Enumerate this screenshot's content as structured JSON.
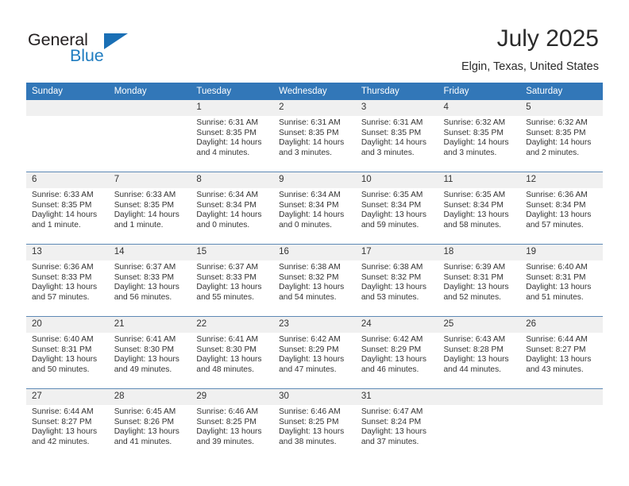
{
  "brand": {
    "name_part1": "General",
    "name_part2": "Blue",
    "accent_color": "#1f7cc0"
  },
  "header": {
    "title": "July 2025",
    "location": "Elgin, Texas, United States"
  },
  "calendar": {
    "header_bg": "#3277b8",
    "daynum_bg": "#f0f0f0",
    "weekday_names": [
      "Sunday",
      "Monday",
      "Tuesday",
      "Wednesday",
      "Thursday",
      "Friday",
      "Saturday"
    ],
    "weeks": [
      [
        {
          "day": "",
          "blank": true
        },
        {
          "day": "",
          "blank": true
        },
        {
          "day": "1",
          "sunrise": "Sunrise: 6:31 AM",
          "sunset": "Sunset: 8:35 PM",
          "daylight_l1": "Daylight: 14 hours",
          "daylight_l2": "and 4 minutes."
        },
        {
          "day": "2",
          "sunrise": "Sunrise: 6:31 AM",
          "sunset": "Sunset: 8:35 PM",
          "daylight_l1": "Daylight: 14 hours",
          "daylight_l2": "and 3 minutes."
        },
        {
          "day": "3",
          "sunrise": "Sunrise: 6:31 AM",
          "sunset": "Sunset: 8:35 PM",
          "daylight_l1": "Daylight: 14 hours",
          "daylight_l2": "and 3 minutes."
        },
        {
          "day": "4",
          "sunrise": "Sunrise: 6:32 AM",
          "sunset": "Sunset: 8:35 PM",
          "daylight_l1": "Daylight: 14 hours",
          "daylight_l2": "and 3 minutes."
        },
        {
          "day": "5",
          "sunrise": "Sunrise: 6:32 AM",
          "sunset": "Sunset: 8:35 PM",
          "daylight_l1": "Daylight: 14 hours",
          "daylight_l2": "and 2 minutes."
        }
      ],
      [
        {
          "day": "6",
          "sunrise": "Sunrise: 6:33 AM",
          "sunset": "Sunset: 8:35 PM",
          "daylight_l1": "Daylight: 14 hours",
          "daylight_l2": "and 1 minute."
        },
        {
          "day": "7",
          "sunrise": "Sunrise: 6:33 AM",
          "sunset": "Sunset: 8:35 PM",
          "daylight_l1": "Daylight: 14 hours",
          "daylight_l2": "and 1 minute."
        },
        {
          "day": "8",
          "sunrise": "Sunrise: 6:34 AM",
          "sunset": "Sunset: 8:34 PM",
          "daylight_l1": "Daylight: 14 hours",
          "daylight_l2": "and 0 minutes."
        },
        {
          "day": "9",
          "sunrise": "Sunrise: 6:34 AM",
          "sunset": "Sunset: 8:34 PM",
          "daylight_l1": "Daylight: 14 hours",
          "daylight_l2": "and 0 minutes."
        },
        {
          "day": "10",
          "sunrise": "Sunrise: 6:35 AM",
          "sunset": "Sunset: 8:34 PM",
          "daylight_l1": "Daylight: 13 hours",
          "daylight_l2": "and 59 minutes."
        },
        {
          "day": "11",
          "sunrise": "Sunrise: 6:35 AM",
          "sunset": "Sunset: 8:34 PM",
          "daylight_l1": "Daylight: 13 hours",
          "daylight_l2": "and 58 minutes."
        },
        {
          "day": "12",
          "sunrise": "Sunrise: 6:36 AM",
          "sunset": "Sunset: 8:34 PM",
          "daylight_l1": "Daylight: 13 hours",
          "daylight_l2": "and 57 minutes."
        }
      ],
      [
        {
          "day": "13",
          "sunrise": "Sunrise: 6:36 AM",
          "sunset": "Sunset: 8:33 PM",
          "daylight_l1": "Daylight: 13 hours",
          "daylight_l2": "and 57 minutes."
        },
        {
          "day": "14",
          "sunrise": "Sunrise: 6:37 AM",
          "sunset": "Sunset: 8:33 PM",
          "daylight_l1": "Daylight: 13 hours",
          "daylight_l2": "and 56 minutes."
        },
        {
          "day": "15",
          "sunrise": "Sunrise: 6:37 AM",
          "sunset": "Sunset: 8:33 PM",
          "daylight_l1": "Daylight: 13 hours",
          "daylight_l2": "and 55 minutes."
        },
        {
          "day": "16",
          "sunrise": "Sunrise: 6:38 AM",
          "sunset": "Sunset: 8:32 PM",
          "daylight_l1": "Daylight: 13 hours",
          "daylight_l2": "and 54 minutes."
        },
        {
          "day": "17",
          "sunrise": "Sunrise: 6:38 AM",
          "sunset": "Sunset: 8:32 PM",
          "daylight_l1": "Daylight: 13 hours",
          "daylight_l2": "and 53 minutes."
        },
        {
          "day": "18",
          "sunrise": "Sunrise: 6:39 AM",
          "sunset": "Sunset: 8:31 PM",
          "daylight_l1": "Daylight: 13 hours",
          "daylight_l2": "and 52 minutes."
        },
        {
          "day": "19",
          "sunrise": "Sunrise: 6:40 AM",
          "sunset": "Sunset: 8:31 PM",
          "daylight_l1": "Daylight: 13 hours",
          "daylight_l2": "and 51 minutes."
        }
      ],
      [
        {
          "day": "20",
          "sunrise": "Sunrise: 6:40 AM",
          "sunset": "Sunset: 8:31 PM",
          "daylight_l1": "Daylight: 13 hours",
          "daylight_l2": "and 50 minutes."
        },
        {
          "day": "21",
          "sunrise": "Sunrise: 6:41 AM",
          "sunset": "Sunset: 8:30 PM",
          "daylight_l1": "Daylight: 13 hours",
          "daylight_l2": "and 49 minutes."
        },
        {
          "day": "22",
          "sunrise": "Sunrise: 6:41 AM",
          "sunset": "Sunset: 8:30 PM",
          "daylight_l1": "Daylight: 13 hours",
          "daylight_l2": "and 48 minutes."
        },
        {
          "day": "23",
          "sunrise": "Sunrise: 6:42 AM",
          "sunset": "Sunset: 8:29 PM",
          "daylight_l1": "Daylight: 13 hours",
          "daylight_l2": "and 47 minutes."
        },
        {
          "day": "24",
          "sunrise": "Sunrise: 6:42 AM",
          "sunset": "Sunset: 8:29 PM",
          "daylight_l1": "Daylight: 13 hours",
          "daylight_l2": "and 46 minutes."
        },
        {
          "day": "25",
          "sunrise": "Sunrise: 6:43 AM",
          "sunset": "Sunset: 8:28 PM",
          "daylight_l1": "Daylight: 13 hours",
          "daylight_l2": "and 44 minutes."
        },
        {
          "day": "26",
          "sunrise": "Sunrise: 6:44 AM",
          "sunset": "Sunset: 8:27 PM",
          "daylight_l1": "Daylight: 13 hours",
          "daylight_l2": "and 43 minutes."
        }
      ],
      [
        {
          "day": "27",
          "sunrise": "Sunrise: 6:44 AM",
          "sunset": "Sunset: 8:27 PM",
          "daylight_l1": "Daylight: 13 hours",
          "daylight_l2": "and 42 minutes."
        },
        {
          "day": "28",
          "sunrise": "Sunrise: 6:45 AM",
          "sunset": "Sunset: 8:26 PM",
          "daylight_l1": "Daylight: 13 hours",
          "daylight_l2": "and 41 minutes."
        },
        {
          "day": "29",
          "sunrise": "Sunrise: 6:46 AM",
          "sunset": "Sunset: 8:25 PM",
          "daylight_l1": "Daylight: 13 hours",
          "daylight_l2": "and 39 minutes."
        },
        {
          "day": "30",
          "sunrise": "Sunrise: 6:46 AM",
          "sunset": "Sunset: 8:25 PM",
          "daylight_l1": "Daylight: 13 hours",
          "daylight_l2": "and 38 minutes."
        },
        {
          "day": "31",
          "sunrise": "Sunrise: 6:47 AM",
          "sunset": "Sunset: 8:24 PM",
          "daylight_l1": "Daylight: 13 hours",
          "daylight_l2": "and 37 minutes."
        },
        {
          "day": "",
          "blank": true
        },
        {
          "day": "",
          "blank": true
        }
      ]
    ]
  }
}
